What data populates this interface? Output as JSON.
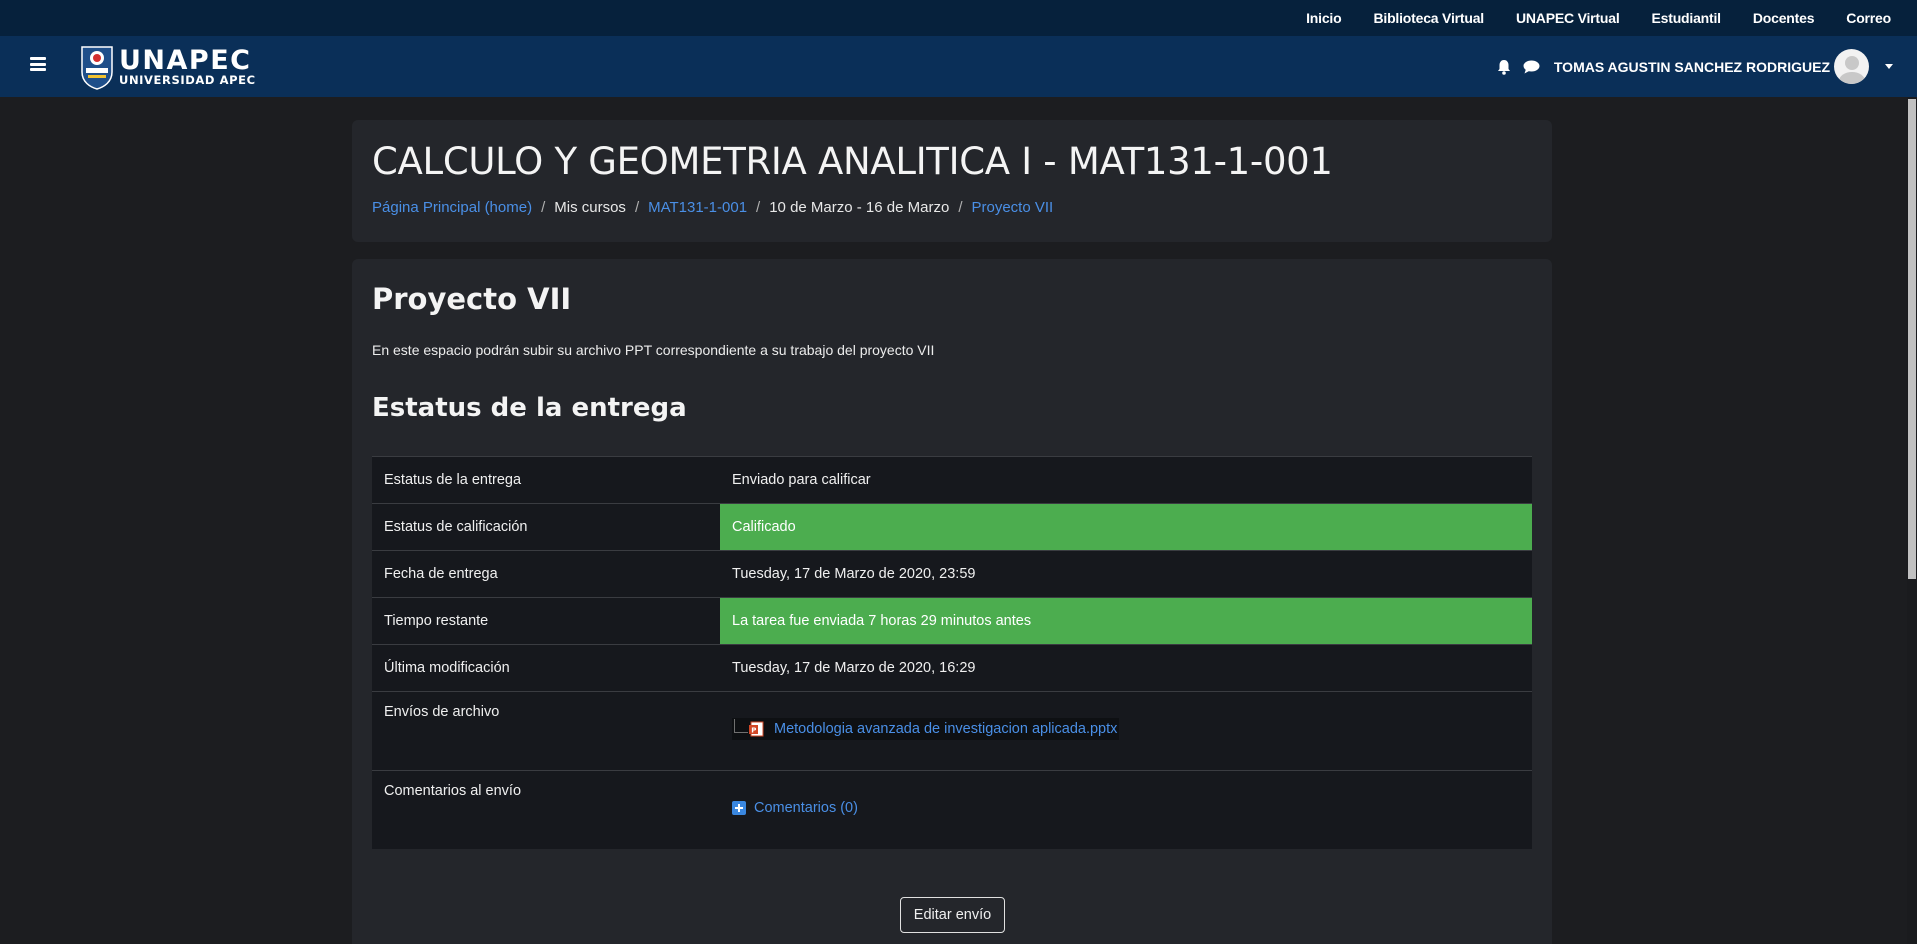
{
  "topbar": {
    "links": [
      "Inicio",
      "Biblioteca Virtual",
      "UNAPEC Virtual",
      "Estudiantil",
      "Docentes",
      "Correo"
    ]
  },
  "navbar": {
    "logo_main": "UNAPEC",
    "logo_sub": "UNIVERSIDAD APEC",
    "user_name": "TOMAS AGUSTIN SANCHEZ RODRIGUEZ"
  },
  "header": {
    "title": "CALCULO Y GEOMETRIA ANALITICA I - MAT131-1-001",
    "breadcrumb": [
      "Página Principal (home)",
      "Mis cursos",
      "MAT131-1-001",
      "10 de Marzo - 16 de Marzo",
      "Proyecto VII"
    ]
  },
  "assignment": {
    "title": "Proyecto VII",
    "description": "En este espacio podrán subir su archivo PPT correspondiente a su trabajo del proyecto VII",
    "status_heading": "Estatus de la entrega",
    "rows": [
      {
        "label": "Estatus de la entrega",
        "value": "Enviado para calificar"
      },
      {
        "label": "Estatus de calificación",
        "value": "Calificado"
      },
      {
        "label": "Fecha de entrega",
        "value": "Tuesday, 17 de Marzo de 2020, 23:59"
      },
      {
        "label": "Tiempo restante",
        "value": "La tarea fue enviada 7 horas 29 minutos antes"
      },
      {
        "label": "Última modificación",
        "value": "Tuesday, 17 de Marzo de 2020, 16:29"
      },
      {
        "label": "Envíos de archivo",
        "value": "Metodologia avanzada de investigacion aplicada.pptx"
      },
      {
        "label": "Comentarios al envío",
        "value": "Comentarios (0)"
      }
    ],
    "edit_button": "Editar envío"
  },
  "colors": {
    "success": "#4cad4f",
    "link": "#4a8fe6",
    "topbar": "#06213c",
    "navbar": "#0a2f58"
  }
}
